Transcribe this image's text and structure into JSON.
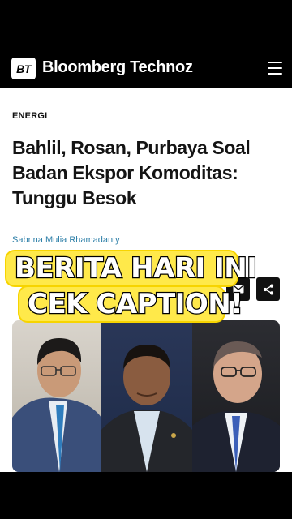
{
  "header": {
    "logo_text": "BT",
    "brand_name": "Bloomberg Technoz",
    "menu_icon": "hamburger-menu-icon"
  },
  "article": {
    "category": "ENERGI",
    "title": "Bahlil, Rosan, Purbaya Soal Badan Ekspor Komoditas: Tunggu Besok",
    "author": "Sabrina Mulia Rhamadanty"
  },
  "share": {
    "email_icon": "email-icon",
    "share_icon": "share-icon"
  },
  "caption": {
    "line1": "BERITA HARI INI",
    "line2": "CEK CAPTION!"
  },
  "colors": {
    "background": "#000000",
    "article_background": "#ffffff",
    "author_link": "#2d7fa8",
    "caption_highlight": "#ffe94a"
  }
}
